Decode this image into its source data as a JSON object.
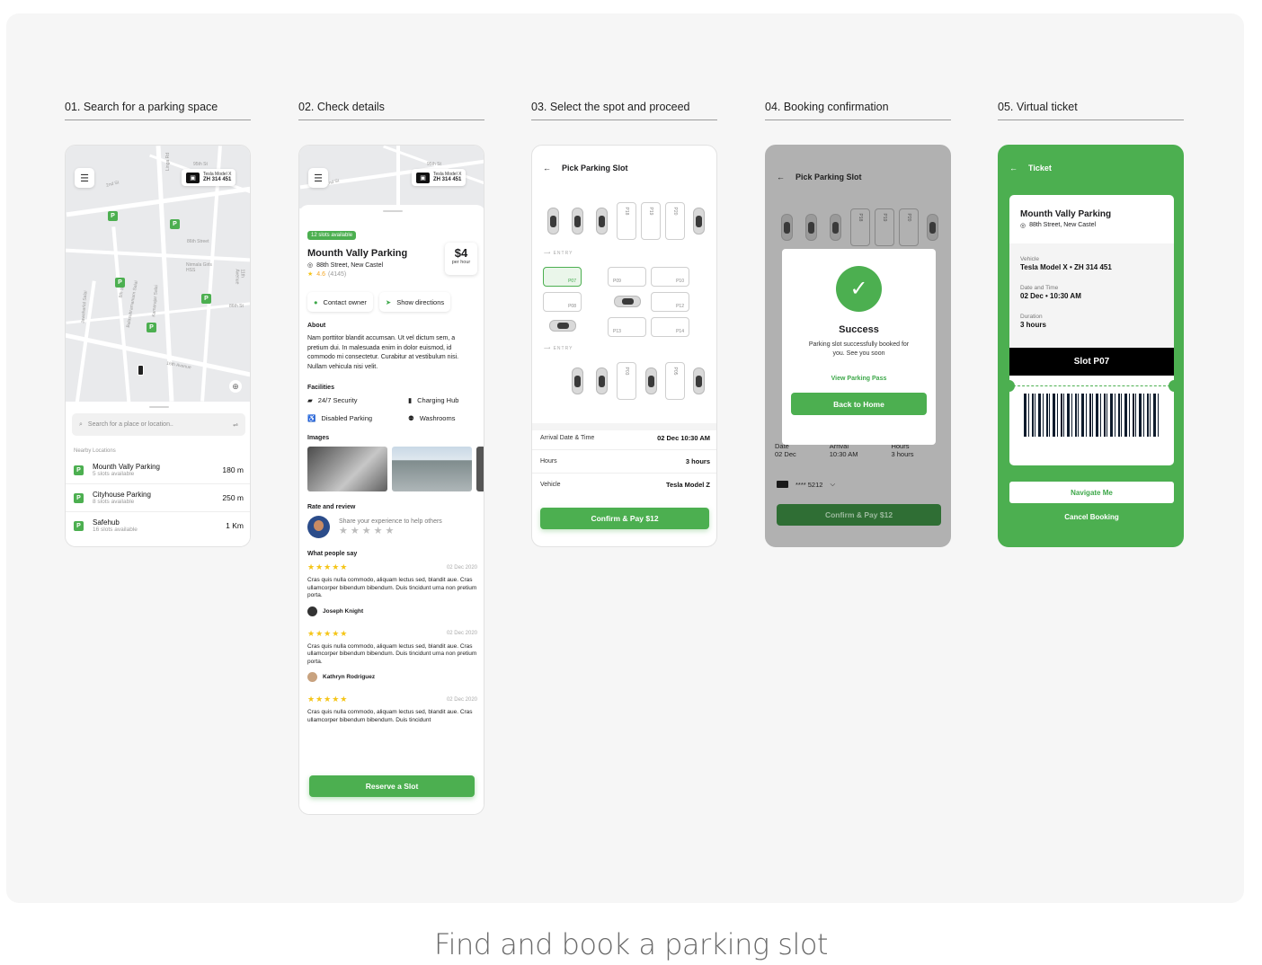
{
  "caption": "Find and book a parking slot",
  "colors": {
    "accent": "#4caf50",
    "board": "#f6f6f6"
  },
  "steps": [
    "01. Search for a parking space",
    "02. Check details",
    "03. Select the spot and proceed",
    "04. Booking confirmation",
    "05. Virtual ticket"
  ],
  "map": {
    "vehicle_model": "Tesla Model X",
    "vehicle_plate": "ZH 314 451",
    "street_labels": [
      "95th St",
      "2nd St",
      "86th Street",
      "16th Avenue",
      "Nirmala Girls HSS",
      "8th St",
      "Kamarajar Salai",
      "Balasubramaniam Salai",
      "Jawaharlal Salai",
      "Linga Rd",
      "11th Avenue",
      "86th St"
    ]
  },
  "screen1": {
    "search_placeholder": "Search for a place or location..",
    "nearby_label": "Nearby Locations",
    "locations": [
      {
        "name": "Mounth Vally Parking",
        "slots": "5 slots available",
        "dist": "180 m"
      },
      {
        "name": "Cityhouse Parking",
        "slots": "8 slots available",
        "dist": "250 m"
      },
      {
        "name": "Safehub",
        "slots": "16 slots available",
        "dist": "1 Km"
      }
    ]
  },
  "screen2": {
    "slots_badge": "12 slots available",
    "name": "Mounth Vally Parking",
    "address": "88th Street, New Castel",
    "rating": "4.6",
    "reviews_count": "(4145)",
    "price": "$4",
    "price_unit": "per hour",
    "contact_btn": "Contact owner",
    "directions_btn": "Show directions",
    "about_title": "About",
    "about_text": "Nam porttitor blandit accumsan. Ut vel dictum sem, a pretium dui. In malesuada enim in dolor euismod, id commodo mi consectetur. Curabitur at vestibulum nisi. Nullam vehicula nisi velit.",
    "facilities_title": "Facilities",
    "facilities": [
      "24/7 Security",
      "Charging Hub",
      "Disabled Parking",
      "Washrooms"
    ],
    "images_title": "Images",
    "rate_title": "Rate and review",
    "rate_prompt": "Share your experience to help others",
    "people_title": "What people say",
    "reviews": [
      {
        "date": "02 Dec 2020",
        "text": "Cras quis nulla commodo, aliquam lectus sed, blandit aue. Cras ullamcorper bibendum bibendum. Duis tincidunt urna non pretium porta.",
        "author": "Joseph Knight"
      },
      {
        "date": "02 Dec 2020",
        "text": "Cras quis nulla commodo, aliquam lectus sed, blandit aue. Cras ullamcorper bibendum bibendum. Duis tincidunt urna non pretium porta.",
        "author": "Kathryn Rodriguez"
      },
      {
        "date": "02 Dec 2020",
        "text": "Cras quis nulla commodo, aliquam lectus sed, blandit aue. Cras ullamcorper bibendum bibendum. Duis tincidunt",
        "author": ""
      }
    ],
    "reserve_btn": "Reserve a Slot"
  },
  "screen3": {
    "title": "Pick Parking Slot",
    "entry": "ENTRY",
    "slot_labels": {
      "p18": "P18",
      "p19": "P19",
      "p20": "P20",
      "p07": "P07",
      "p08": "P08",
      "p09": "P09",
      "p10": "P10",
      "p12": "P12",
      "p13": "P13",
      "p14": "P14",
      "p03": "P03",
      "p05": "P05"
    },
    "rows": [
      {
        "label": "Arrival Date & Time",
        "value": "02 Dec 10:30 AM"
      },
      {
        "label": "Hours",
        "value": "3 hours"
      },
      {
        "label": "Vehicle",
        "value": "Tesla Model Z"
      }
    ],
    "confirm_btn": "Confirm & Pay $12"
  },
  "screen4": {
    "title": "Pick Parking Slot",
    "success_title": "Success",
    "success_text": "Parking slot successfully booked for you. See you soon",
    "view_pass": "View Parking Pass",
    "back_home": "Back to Home",
    "bg_cols": [
      {
        "label": "Date",
        "value": "02 Dec"
      },
      {
        "label": "Arrival",
        "value": "10:30 AM"
      },
      {
        "label": "Hours",
        "value": "3 hours"
      }
    ],
    "card": "**** 5212",
    "confirm_btn": "Confirm & Pay $12"
  },
  "screen5": {
    "title": "Ticket",
    "name": "Mounth Vally Parking",
    "address": "88th Street, New Castel",
    "vehicle_label": "Vehicle",
    "vehicle_value": "Tesla Model X • ZH 314 451",
    "datetime_label": "Date and Time",
    "datetime_value": "02 Dec • 10:30 AM",
    "duration_label": "Duration",
    "duration_value": "3 hours",
    "slot": "Slot P07",
    "navigate_btn": "Navigate Me",
    "cancel_btn": "Cancel Booking"
  }
}
